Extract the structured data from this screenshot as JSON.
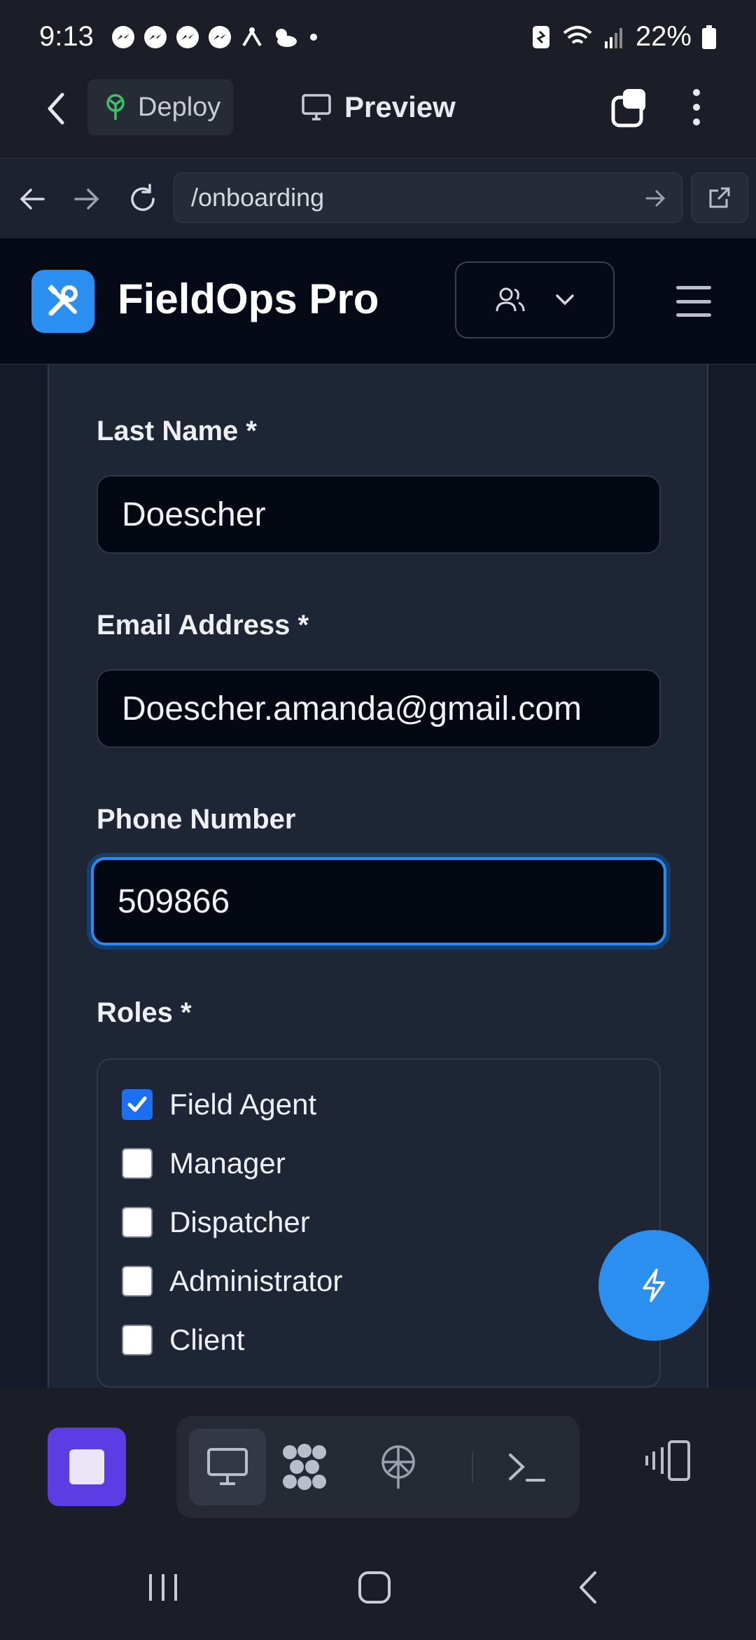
{
  "status_bar": {
    "time": "9:13",
    "battery": "22%",
    "notification_icons": [
      "messenger-icon",
      "messenger-icon",
      "messenger-icon",
      "messenger-icon",
      "app-icon",
      "weather-icon",
      "dot-icon"
    ]
  },
  "app_bar": {
    "deploy_label": "Deploy",
    "preview_label": "Preview"
  },
  "browser": {
    "url": "/onboarding"
  },
  "site": {
    "brand_name": "FieldOps Pro",
    "brand_color": "#2a8ff0"
  },
  "form": {
    "last_name": {
      "label": "Last Name *",
      "value": "Doescher"
    },
    "email": {
      "label": "Email Address *",
      "value": "Doescher.amanda@gmail.com"
    },
    "phone": {
      "label": "Phone Number",
      "value": "509866"
    },
    "roles": {
      "label": "Roles *",
      "options": [
        {
          "label": "Field Agent",
          "checked": true
        },
        {
          "label": "Manager",
          "checked": false
        },
        {
          "label": "Dispatcher",
          "checked": false
        },
        {
          "label": "Administrator",
          "checked": false
        },
        {
          "label": "Client",
          "checked": false
        }
      ]
    }
  },
  "toolbar": {
    "tools": [
      "monitor-icon",
      "apps-icon",
      "antenna-icon",
      "terminal-icon"
    ],
    "active_tool": "monitor-icon",
    "stop_color": "#5b3de3"
  }
}
